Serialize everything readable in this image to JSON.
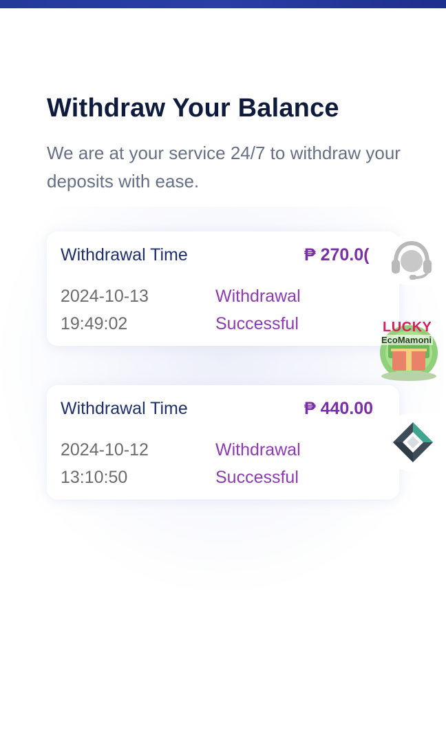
{
  "header": {
    "title": "Withdraw Your Balance",
    "subtitle": "We are at your service 24/7 to withdraw your deposits with ease."
  },
  "withdrawals": [
    {
      "label": "Withdrawal Time",
      "amount": "₱ 270.0(",
      "date": "2024-10-13",
      "time": "19:49:02",
      "status_line1": "Withdrawal",
      "status_line2": "Successful"
    },
    {
      "label": "Withdrawal Time",
      "amount": "₱ 440.00",
      "date": "2024-10-12",
      "time": "13:10:50",
      "status_line1": "Withdrawal",
      "status_line2": "Successful"
    }
  ],
  "floating": {
    "support_icon": "headset-icon",
    "promo_badge": {
      "line1": "LUCKY",
      "line2": "EcoMamoni",
      "icon": "money-gift-icon"
    },
    "logo_icon": "diamond-logo-icon"
  },
  "colors": {
    "topbar": "#243a9a",
    "title": "#0e1b3d",
    "label": "#1e2f6b",
    "amount": "#7a2fa6",
    "status": "#8b3cb0"
  }
}
